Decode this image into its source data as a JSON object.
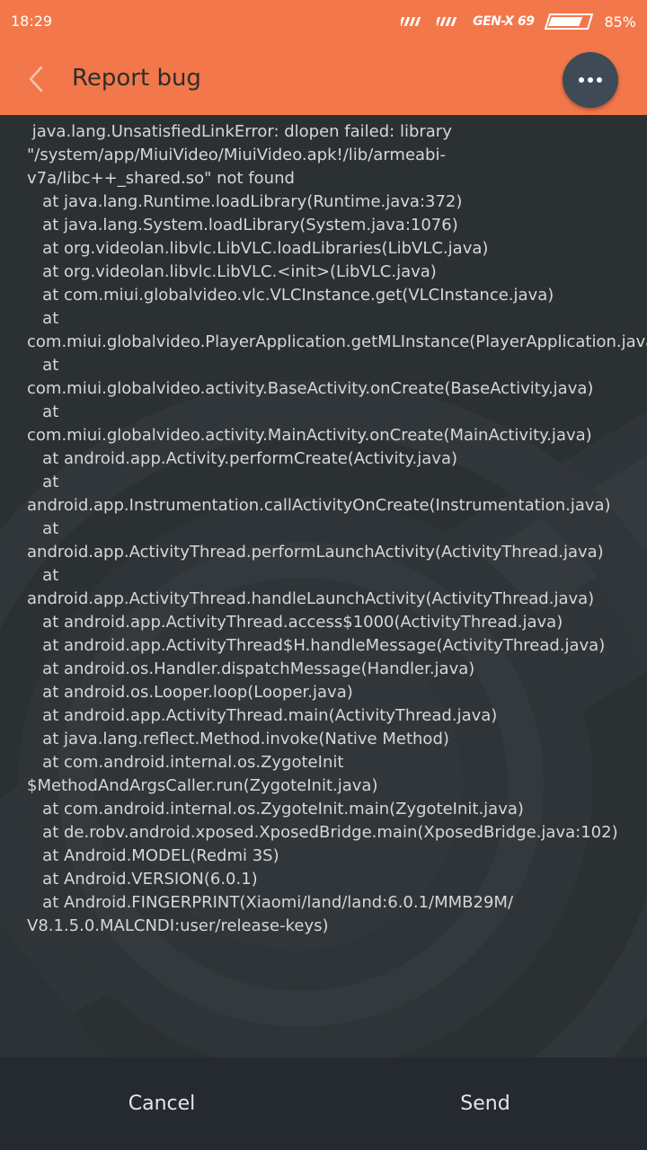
{
  "status_bar": {
    "time": "18:29",
    "carrier": "GEN-X 69",
    "battery_percent_text": "85%",
    "battery_level": 0.85,
    "icons": [
      "signal-icon",
      "signal-icon",
      "battery-icon"
    ]
  },
  "app_bar": {
    "title": "Report bug",
    "back_icon": "back-arrow-icon",
    "menu_icon": "more-dots-icon"
  },
  "log": {
    "text": " java.lang.UnsatisfiedLinkError: dlopen failed: library \"/system/app/MiuiVideo/MiuiVideo.apk!/lib/armeabi-v7a/libc++_shared.so\" not found\n   at java.lang.Runtime.loadLibrary(Runtime.java:372)\n   at java.lang.System.loadLibrary(System.java:1076)\n   at org.videolan.libvlc.LibVLC.loadLibraries(LibVLC.java)\n   at org.videolan.libvlc.LibVLC.<init>(LibVLC.java)\n   at com.miui.globalvideo.vlc.VLCInstance.get(VLCInstance.java)\n   at\ncom.miui.globalvideo.PlayerApplication.getMLInstance(PlayerApplication.java)\n   at com.miui.globalvideo.activity.BaseActivity.onCreate(BaseActivity.java)\n   at com.miui.globalvideo.activity.MainActivity.onCreate(MainActivity.java)\n   at android.app.Activity.performCreate(Activity.java)\n   at android.app.Instrumentation.callActivityOnCreate(Instrumentation.java)\n   at android.app.ActivityThread.performLaunchActivity(ActivityThread.java)\n   at android.app.ActivityThread.handleLaunchActivity(ActivityThread.java)\n   at android.app.ActivityThread.access$1000(ActivityThread.java)\n   at android.app.ActivityThread$H.handleMessage(ActivityThread.java)\n   at android.os.Handler.dispatchMessage(Handler.java)\n   at android.os.Looper.loop(Looper.java)\n   at android.app.ActivityThread.main(ActivityThread.java)\n   at java.lang.reflect.Method.invoke(Native Method)\n   at com.android.internal.os.ZygoteInit\n$MethodAndArgsCaller.run(ZygoteInit.java)\n   at com.android.internal.os.ZygoteInit.main(ZygoteInit.java)\n   at de.robv.android.xposed.XposedBridge.main(XposedBridge.java:102)\n   at Android.MODEL(Redmi 3S)\n   at Android.VERSION(6.0.1)\n   at Android.FINGERPRINT(Xiaomi/land/land:6.0.1/MMB29M/\nV8.1.5.0.MALCNDI:user/release-keys)"
  },
  "footer": {
    "cancel_label": "Cancel",
    "send_label": "Send"
  },
  "colors": {
    "accent": "#f2784b",
    "background": "#2b3033",
    "footer": "#242a2f",
    "menu_button": "#3e4a55",
    "text": "#d6d6d6"
  }
}
